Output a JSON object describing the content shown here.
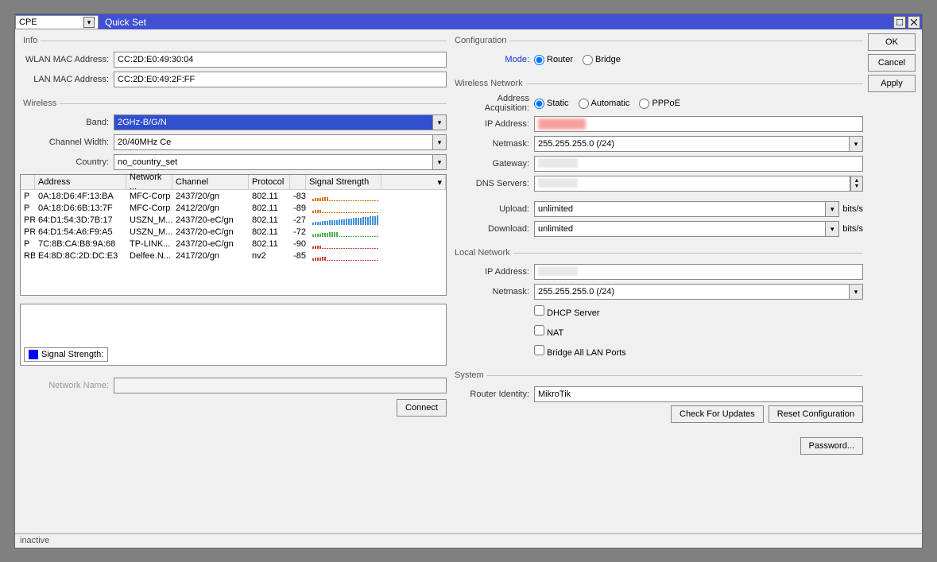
{
  "titlebar": {
    "select_value": "CPE",
    "title": "Quick Set"
  },
  "buttons": {
    "ok": "OK",
    "cancel": "Cancel",
    "apply": "Apply"
  },
  "info": {
    "legend": "Info",
    "wlan_mac_label": "WLAN MAC Address:",
    "wlan_mac": "CC:2D:E0:49:30:04",
    "lan_mac_label": "LAN MAC Address:",
    "lan_mac": "CC:2D:E0:49:2F:FF"
  },
  "wireless": {
    "legend": "Wireless",
    "band_label": "Band:",
    "band": "2GHz-B/G/N",
    "chwidth_label": "Channel Width:",
    "chwidth": "20/40MHz Ce",
    "country_label": "Country:",
    "country": "no_country_set",
    "grid": {
      "headers": [
        "",
        "Address",
        "Network ...",
        "Channel",
        "Protocol",
        "Signal Strength"
      ],
      "rows": [
        {
          "p": "P",
          "addr": "0A:18:D6:4F:13:BA",
          "net": "MFC-Corp",
          "ch": "2437/20/gn",
          "proto": "802.11",
          "sig": "-83",
          "color": "#e07000"
        },
        {
          "p": "P",
          "addr": "0A:18:D6:6B:13:7F",
          "net": "MFC-Corp",
          "ch": "2412/20/gn",
          "proto": "802.11",
          "sig": "-89",
          "color": "#e07000"
        },
        {
          "p": "PR",
          "addr": "64:D1:54:3D:7B:17",
          "net": "USZN_M...",
          "ch": "2437/20-eC/gn",
          "proto": "802.11",
          "sig": "-27",
          "color": "#4090d8"
        },
        {
          "p": "PR",
          "addr": "64:D1:54:A6:F9:A5",
          "net": "USZN_M...",
          "ch": "2437/20-eC/gn",
          "proto": "802.11",
          "sig": "-72",
          "color": "#50b050"
        },
        {
          "p": "P",
          "addr": "7C:8B:CA:B8:9A:68",
          "net": "TP-LINK...",
          "ch": "2437/20-eC/gn",
          "proto": "802.11",
          "sig": "-90",
          "color": "#d04040"
        },
        {
          "p": "RB",
          "addr": "E4:8D:8C:2D:DC:E3",
          "net": "Delfee.N...",
          "ch": "2417/20/gn",
          "proto": "nv2",
          "sig": "-85",
          "color": "#d04040"
        }
      ]
    },
    "sig_label": "Signal Strength:",
    "netname_label": "Network Name:",
    "netname": "",
    "connect": "Connect"
  },
  "config": {
    "legend": "Configuration",
    "mode_label": "Mode:",
    "mode_router": "Router",
    "mode_bridge": "Bridge"
  },
  "wnet": {
    "legend": "Wireless Network",
    "acq_label": "Address Acquisition:",
    "acq_static": "Static",
    "acq_auto": "Automatic",
    "acq_pppoe": "PPPoE",
    "ip_label": "IP Address:",
    "netmask_label": "Netmask:",
    "netmask": "255.255.255.0 (/24)",
    "gateway_label": "Gateway:",
    "dns_label": "DNS Servers:",
    "upload_label": "Upload:",
    "upload": "unlimited",
    "download_label": "Download:",
    "download": "unlimited",
    "unit": "bits/s"
  },
  "lnet": {
    "legend": "Local Network",
    "ip_label": "IP Address:",
    "netmask_label": "Netmask:",
    "netmask": "255.255.255.0 (/24)",
    "dhcp": "DHCP Server",
    "nat": "NAT",
    "bridge": "Bridge All LAN Ports"
  },
  "system": {
    "legend": "System",
    "identity_label": "Router Identity:",
    "identity": "MikroTik",
    "check_updates": "Check For Updates",
    "reset_config": "Reset Configuration",
    "password": "Password..."
  },
  "status": "inactive"
}
